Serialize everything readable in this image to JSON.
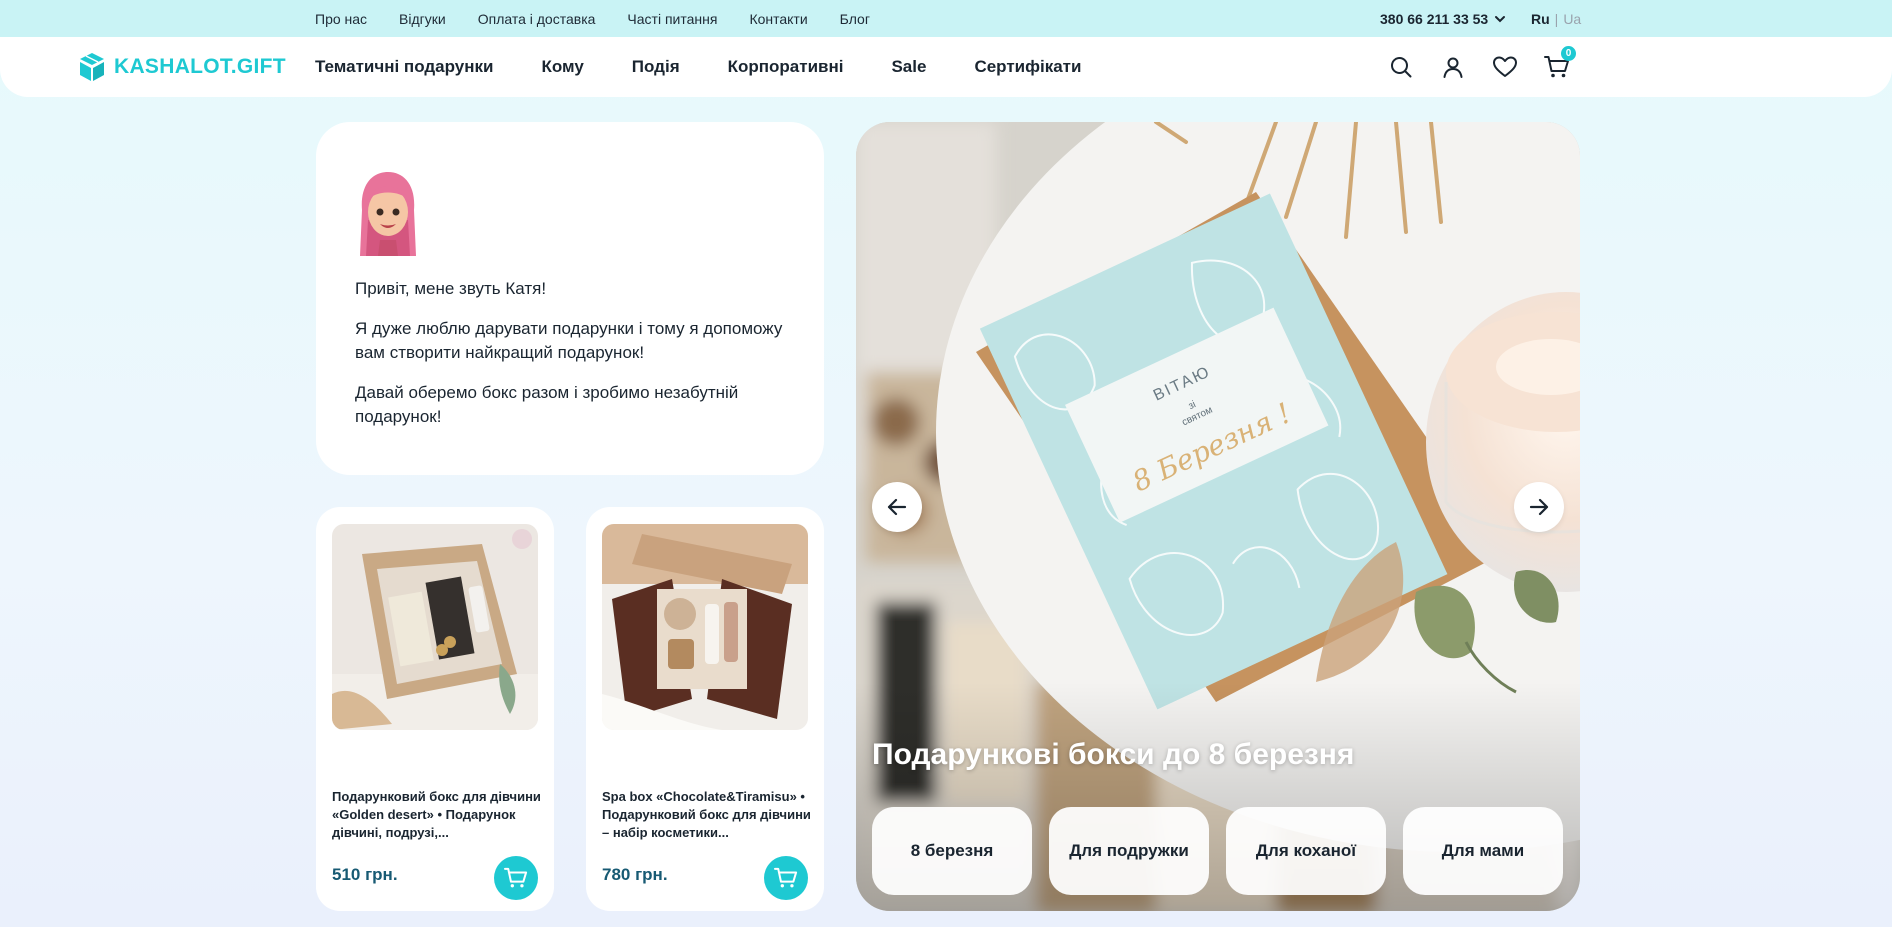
{
  "topbar": {
    "links": [
      "Про нас",
      "Відгуки",
      "Оплата і доставка",
      "Часті питання",
      "Контакти",
      "Блог"
    ],
    "phone": "380 66 211 33 53",
    "lang_ru": "Ru",
    "lang_sep": "|",
    "lang_ua": "Ua"
  },
  "header": {
    "logo_text": "KASHALOT.GIFT",
    "nav": [
      "Тематичні подарунки",
      "Кому",
      "Подія",
      "Корпоративні",
      "Sale",
      "Сертифікати"
    ],
    "cart_count": "0"
  },
  "intro": {
    "greeting": "Привіт, мене звуть Катя!",
    "paragraph1": "Я дуже люблю дарувати подарунки і тому я допоможу вам створити найкращий подарунок!",
    "paragraph2": "Давай оберемо бокс разом і зробимо незабутній подарунок!"
  },
  "products": [
    {
      "name": "Подарунковий бокс для дівчини «Golden desert» • Подарунок дівчині, подрузі,...",
      "price": "510 грн."
    },
    {
      "name": "Spa box «Chocolate&Tiramisu» • Подарунковий бокс для дівчини – набір косметики...",
      "price": "780 грн."
    }
  ],
  "hero": {
    "card_text_1": "ВІТАЮ",
    "card_text_2": "зі",
    "card_text_3": "святом",
    "card_text_4": "8 Березня !",
    "title": "Подарункові бокси до 8 березня",
    "chips": [
      "8 березня",
      "Для подружки",
      "Для коханої",
      "Для мами"
    ]
  },
  "colors": {
    "accent": "#1ec9d2",
    "topbar_bg": "#c9f3f5",
    "price": "#175a73"
  }
}
